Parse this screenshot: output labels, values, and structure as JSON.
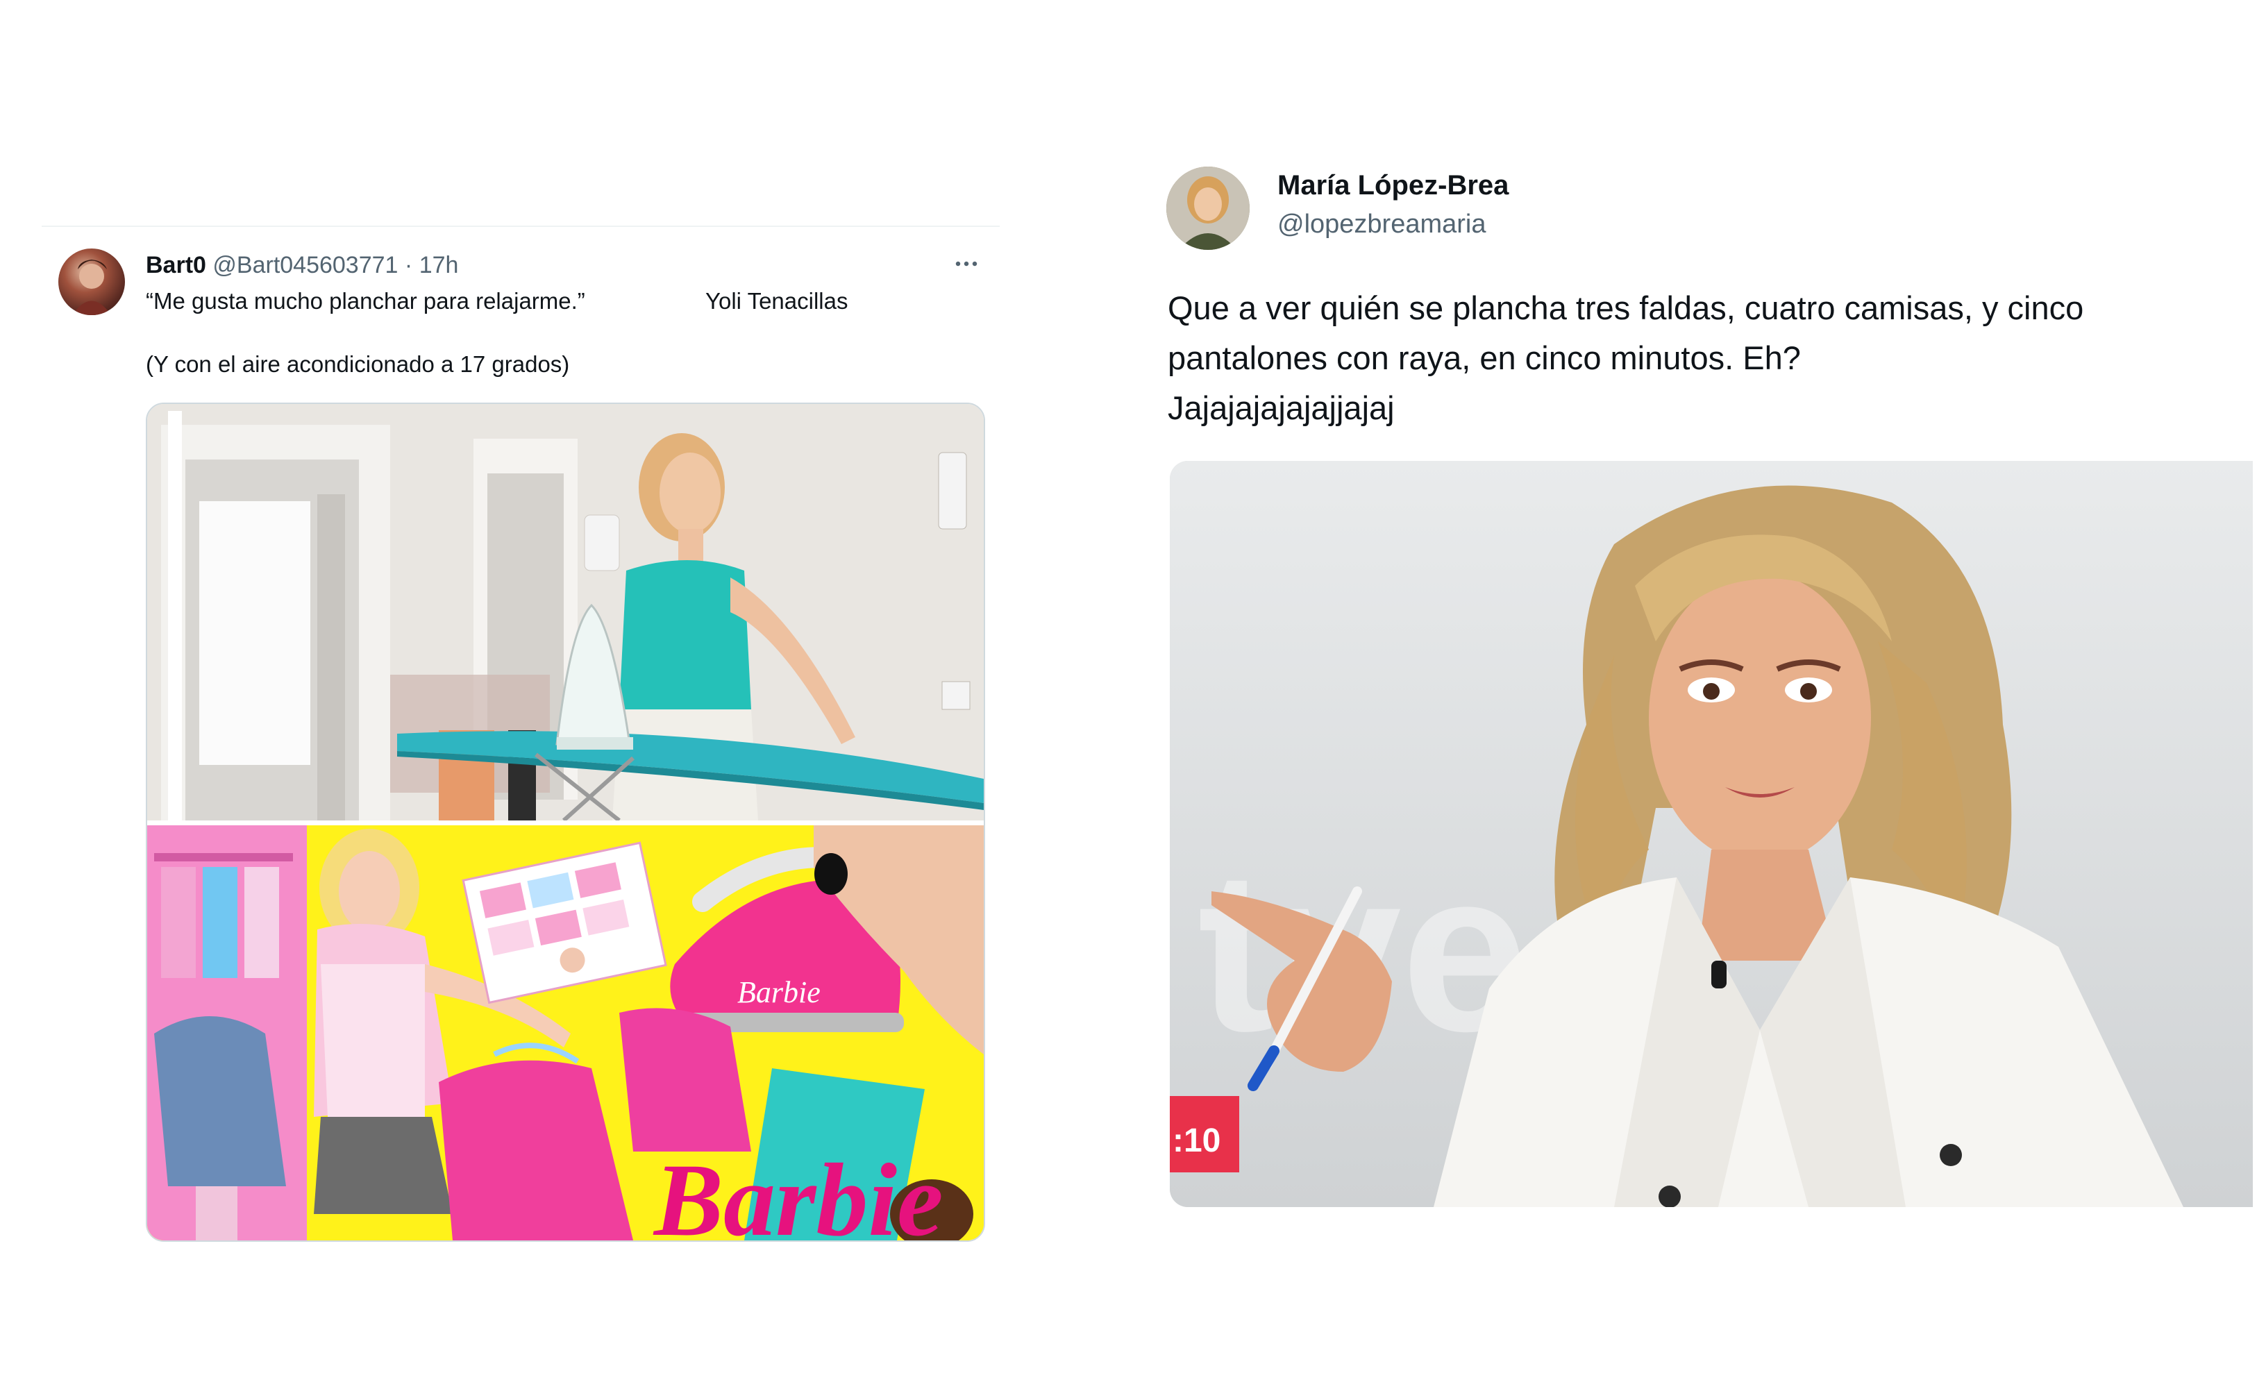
{
  "left_tweet": {
    "display_name": "Bart0",
    "handle": "@Bart045603771",
    "separator": "·",
    "time": "17h",
    "more_icon": "more-horizontal-icon",
    "text_line1": "“Me gusta mucho planchar para relajarme.”",
    "text_line1_name": "Yoli Tenacillas",
    "text_line2": "(Y con el aire acondicionado a 17 grados)",
    "media": {
      "bottom_logo_text": "Barbie",
      "iron_brand_text": "Barbie"
    }
  },
  "right_tweet": {
    "display_name": "María López-Brea",
    "handle": "@lopezbreamaria",
    "text_lines": [
      "Que a ver quién se plancha tres faldas, cuatro camisas, y cinco",
      "pantalones con raya, en cinco minutos. Eh?",
      "Jajajajajajajjajaj"
    ],
    "media": {
      "watermark_text": "tve",
      "clock_text": ":10"
    }
  },
  "colors": {
    "text_primary": "#0f1419",
    "text_secondary": "#536471",
    "divider": "#eff3f4",
    "barbie_pink": "#e6127e",
    "tve_red": "#e8314a"
  }
}
